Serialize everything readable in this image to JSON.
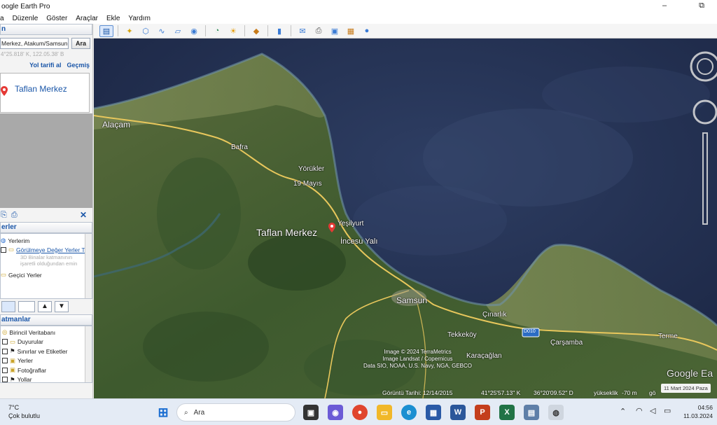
{
  "window": {
    "title": "oogle Earth Pro",
    "minimize": "–",
    "maximize": "⧉"
  },
  "menu": [
    "a",
    "Düzenle",
    "Göster",
    "Araçlar",
    "Ekle",
    "Yardım"
  ],
  "search": {
    "header": "n",
    "input_value": "Merkez, Atakum/Samsun",
    "button": "Ara",
    "coords": "4°25.818' K, 122.05.38' B",
    "directions_link": "Yol tarifi al",
    "history_link": "Geçmiş",
    "result": "Taflan Merkez"
  },
  "places": {
    "header": "erler",
    "items": [
      {
        "label": "Yerlerim",
        "type": "root"
      },
      {
        "label": "Görülmeye Değer Yerler T",
        "type": "link"
      },
      {
        "label": "3D Binalar katmanının",
        "type": "note"
      },
      {
        "label": "işaretli olduğundan emin",
        "type": "note"
      },
      {
        "label": "Geçici Yerler",
        "type": "folder"
      }
    ]
  },
  "layers": {
    "header": "atmanlar",
    "items": [
      "Birincil Veritabanı",
      "Duyurular",
      "Sınırlar ve Etiketler",
      "Yerler",
      "Fotoğraflar",
      "Yollar"
    ]
  },
  "map": {
    "labels": [
      {
        "text": "Alaçam",
        "size": "large"
      },
      {
        "text": "Bafra",
        "size": "small"
      },
      {
        "text": "Yörükler",
        "size": "small"
      },
      {
        "text": "19 Mayıs",
        "size": "small"
      },
      {
        "text": "Yeşilyurt",
        "size": "small"
      },
      {
        "text": "Taflan Merkez",
        "size": "xl"
      },
      {
        "text": "İncesu Yalı",
        "size": "small"
      },
      {
        "text": "Samsun",
        "size": "large"
      },
      {
        "text": "Çınarlık",
        "size": "small"
      },
      {
        "text": "Tekkeköy",
        "size": "small"
      },
      {
        "text": "Karaçağlan",
        "size": "small"
      },
      {
        "text": "Çarşamba",
        "size": "small"
      },
      {
        "text": "Terme",
        "size": "small"
      }
    ],
    "road_badge": "D010",
    "attribution": [
      "Image © 2024 TerraMetrics",
      "Image Landsat / Copernicus",
      "Data SIO, NOAA, U.S. Navy, NGA, GEBCO"
    ],
    "logo": "Google Ea",
    "date_chip": "11 Mart 2024 Paza",
    "status": {
      "imagery_date": "Görüntü Tarihi: 12/14/2015",
      "lat": "41°25'57.13\" K",
      "lon": "36°20'09.52\" D",
      "elevation_label": "yükseklik",
      "elevation": "-70 m",
      "eye": "gö"
    }
  },
  "taskbar": {
    "weather_temp": "7°C",
    "weather_desc": "Çok bulutlu",
    "search_placeholder": "Ara",
    "time": "04:56",
    "date": "11.03.2024"
  }
}
